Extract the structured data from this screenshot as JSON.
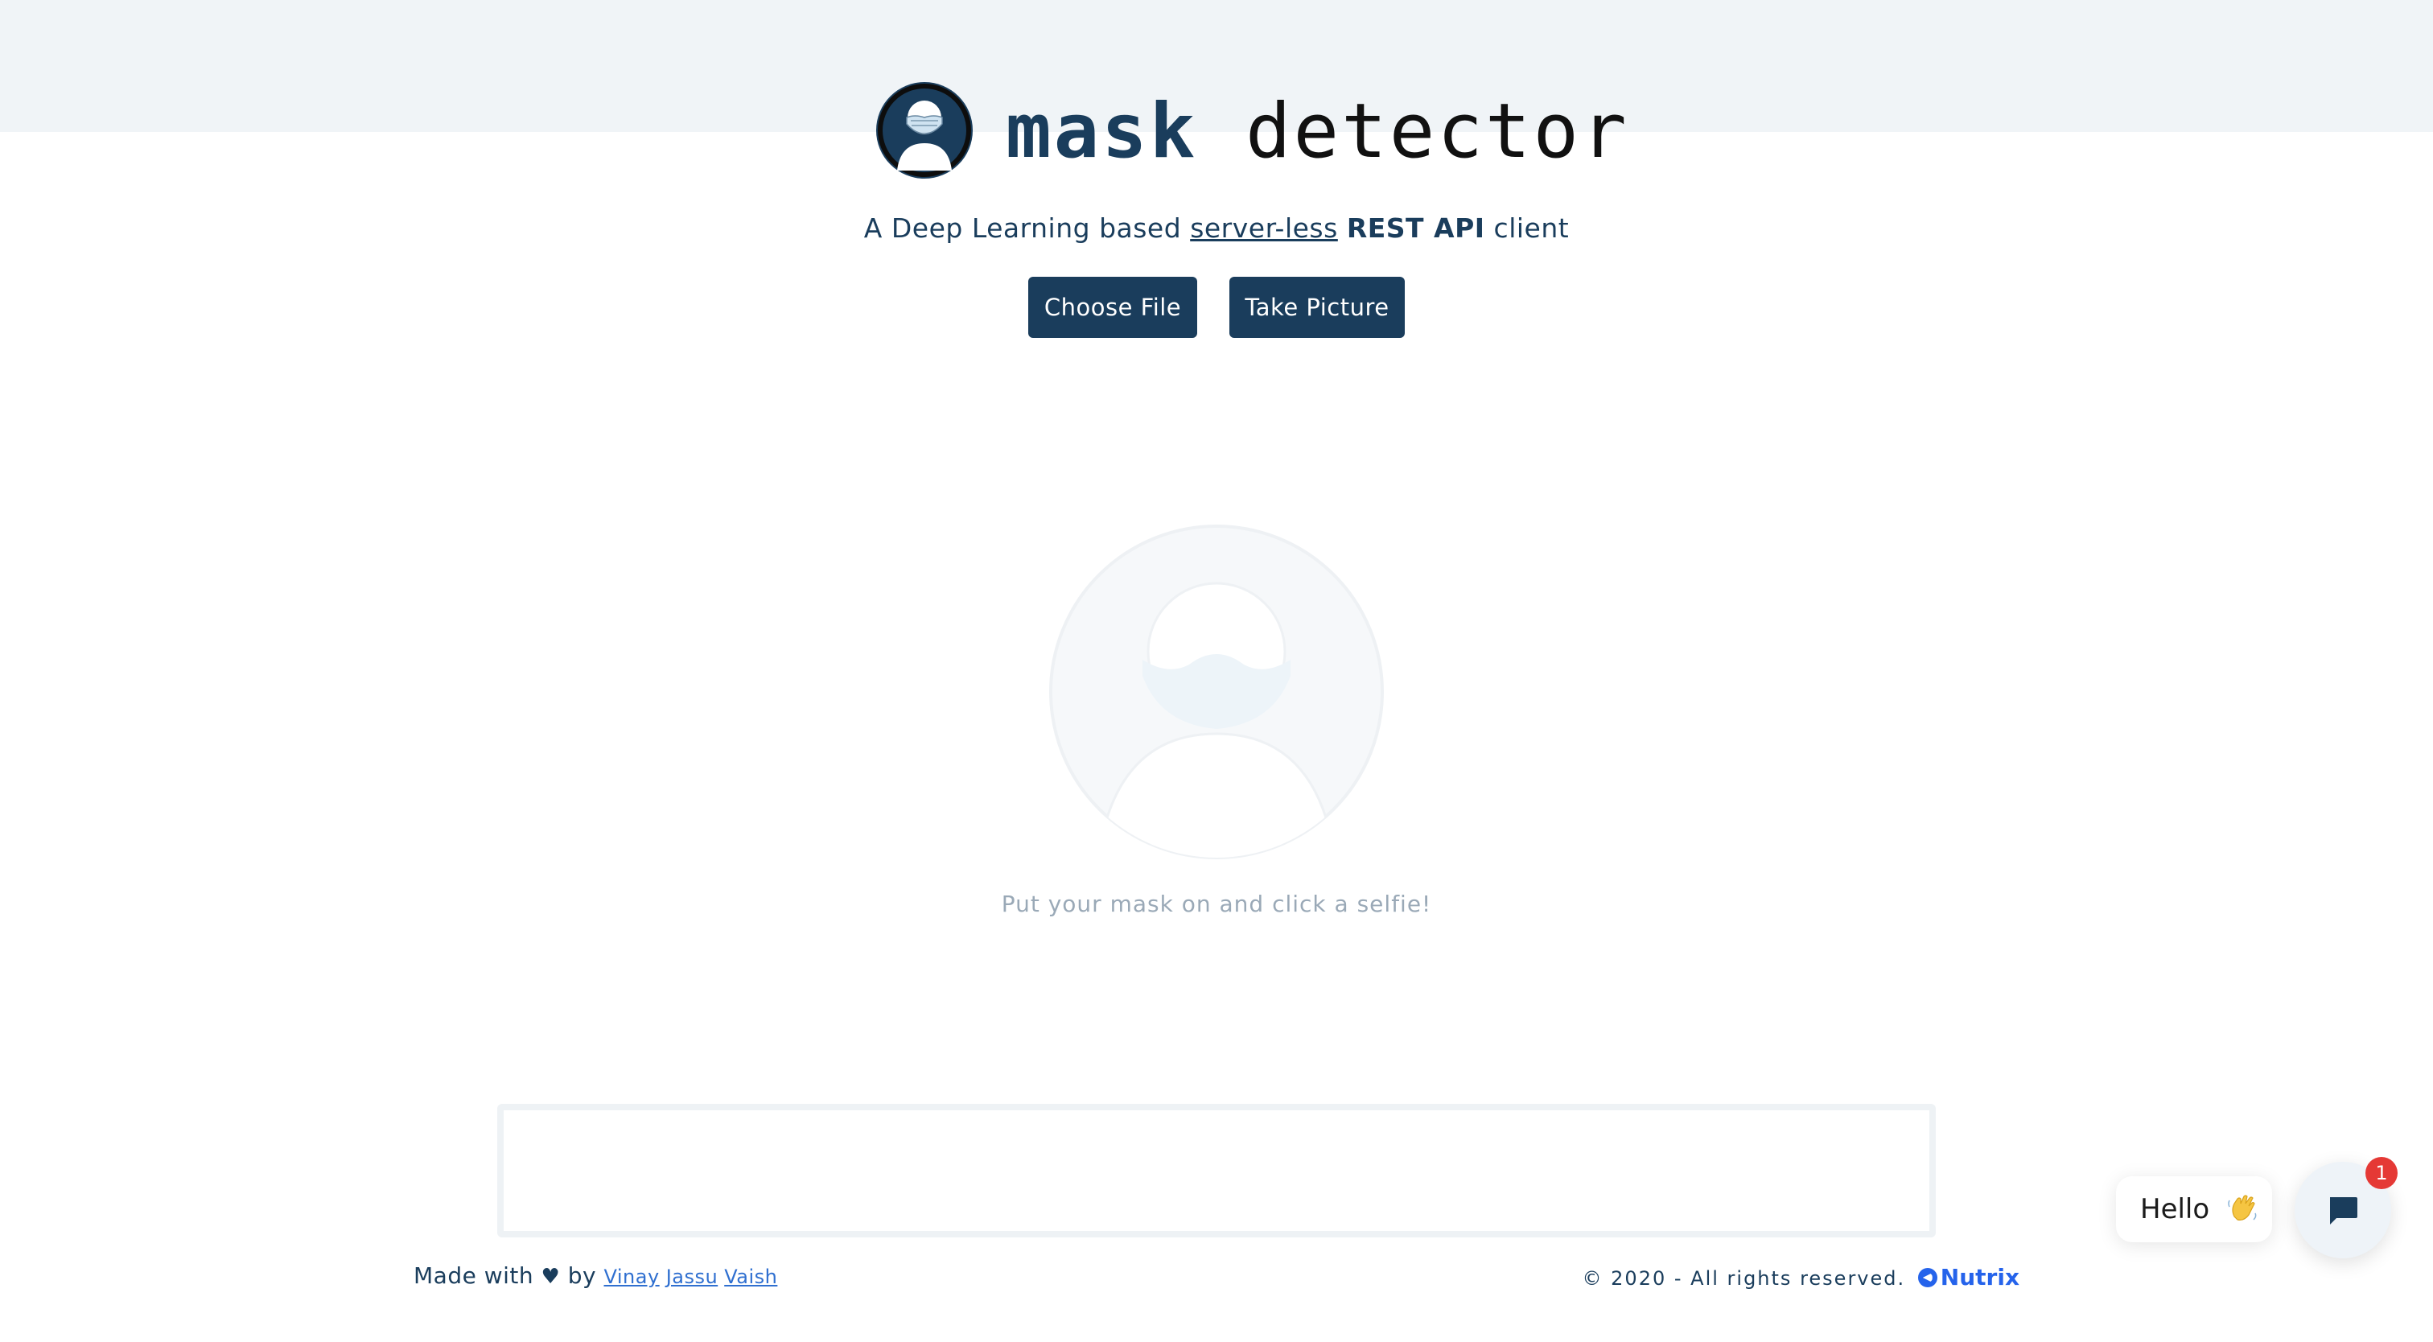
{
  "header": {
    "logo_icon": "masked-person-icon",
    "title_part1": "mask",
    "title_part2": "detector",
    "subtitle": {
      "prefix": "A Deep Learning based",
      "link": "server-less",
      "bold": "REST API",
      "suffix": "client"
    }
  },
  "actions": {
    "choose_file_label": "Choose File",
    "take_picture_label": "Take Picture"
  },
  "preview": {
    "placeholder_icon": "masked-person-placeholder-icon",
    "hint": "Put your mask on and click a selfie!"
  },
  "footer": {
    "made_with": "Made with",
    "heart_icon": "heart-icon",
    "by": "by",
    "authors": [
      "Vinay",
      "Jassu",
      "Vaish"
    ],
    "copyright": "© 2020 - All rights reserved.",
    "brand": "Nutrix"
  },
  "chat": {
    "greeting": "Hello",
    "wave_icon": "waving-hand-icon",
    "chat_icon": "chat-bubble-icon",
    "badge_count": "1"
  },
  "colors": {
    "primary": "#1a3d5c",
    "band": "#f0f4f7",
    "hint": "#9aa9b7",
    "link": "#2f6fd0",
    "brand": "#2563eb",
    "badge": "#e53935"
  }
}
